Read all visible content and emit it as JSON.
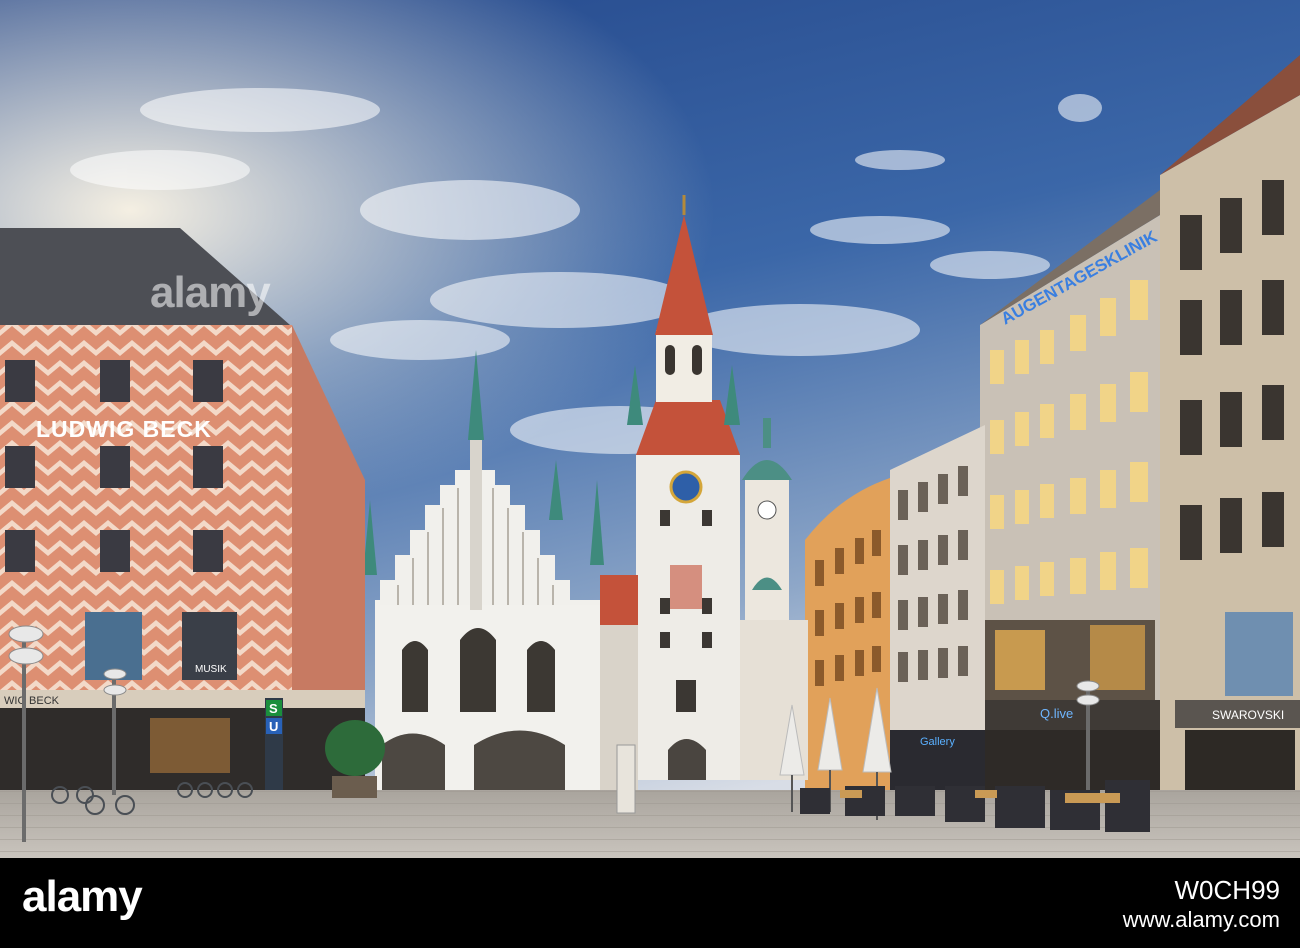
{
  "scene": {
    "ludwig_beck_sign": "LUDWIG BECK",
    "augenklinik_sign": "AUGENTAGESKLINIK",
    "swarovski_sign": "SWAROVSKI",
    "ubahn_sign": "U",
    "sbahn_sign": "S",
    "musik_banner": "MUSIK",
    "store_tail": "WIG BECK",
    "q_live": "Q.live",
    "gallery_text": "Gallery"
  },
  "watermark": {
    "main": "alamy"
  },
  "footer": {
    "logo": "alamy",
    "image_id": "W0CH99",
    "site": "www.alamy.com"
  },
  "colors": {
    "sky_top": "#2a4f8f",
    "sky_bottom": "#c9d3e0",
    "ludwig_beck_facade": "#d9866c",
    "townhall_wall": "#f1f0ec",
    "tower_roof": "#c5533a",
    "spire_green": "#3e8a7c",
    "pavement": "#b9b3ab",
    "footer_bg": "#000000"
  }
}
